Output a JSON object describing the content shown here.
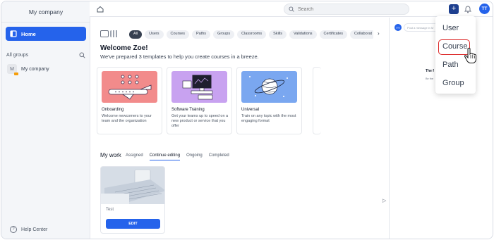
{
  "sidebar": {
    "company": "My company",
    "home_label": "Home",
    "groups_header": "All groups",
    "group_item": "My company",
    "group_avatar_letter": "M",
    "help_label": "Help Center"
  },
  "topbar": {
    "search_placeholder": "Search",
    "plus_label": "+",
    "user_initials": "TT"
  },
  "main": {
    "filters": [
      "All",
      "Users",
      "Courses",
      "Paths",
      "Groups",
      "Classrooms",
      "Skills",
      "Validations",
      "Certificates",
      "Collaborat"
    ],
    "welcome": "Welcome Zoe!",
    "subtitle": "We've prepared 3 templates to help you create courses in a breeze.",
    "templates": [
      {
        "title": "Onboarding",
        "desc": "Welcome newcomers to your team and the organization"
      },
      {
        "title": "Software Training",
        "desc": "Get your teams up to speed on a new product or service that you offer"
      },
      {
        "title": "Universal",
        "desc": "Train on any topic with the most engaging format"
      }
    ],
    "mywork_title": "My work",
    "tabs": [
      "Assigned",
      "Continue editing",
      "Ongoing",
      "Completed"
    ],
    "course_name": "Test",
    "edit_label": "EDIT"
  },
  "right_panel": {
    "avatar": "TT",
    "message_placeholder": "Post a message in M",
    "title": "The f",
    "text": "Be the"
  },
  "dropdown": {
    "items": [
      "User",
      "Course",
      "Path",
      "Group"
    ]
  },
  "colors": {
    "primary": "#2563eb",
    "navy": "#1d3f8f",
    "onboarding_bg": "#f28b8b",
    "software_bg": "#c8a2f0",
    "universal_bg": "#7aa7f0",
    "highlight": "#dc2626"
  }
}
